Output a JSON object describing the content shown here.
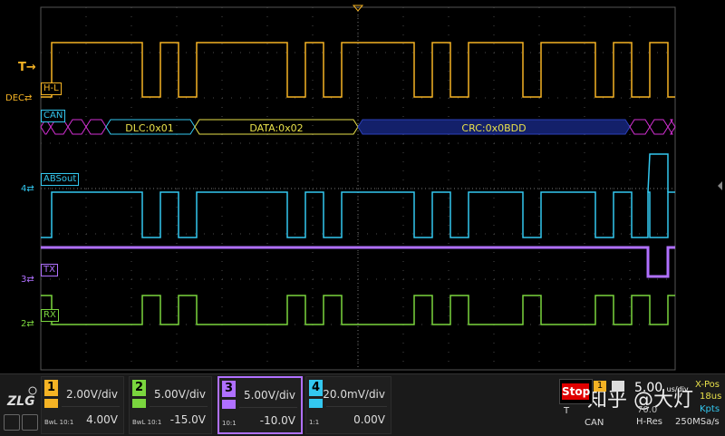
{
  "markers": {
    "trigger": "T",
    "dec": "DEC",
    "ch4_level": "4",
    "ch3_level": "3",
    "ch2_level": "2"
  },
  "trace_labels": {
    "hl": "H-L",
    "can": "CAN",
    "absout": "ABSout",
    "tx": "TX",
    "rx": "RX"
  },
  "decode": {
    "dlc": "DLC:0x01",
    "data": "DATA:0x02",
    "crc": "CRC:0x0BDD"
  },
  "channels": [
    {
      "num": "1",
      "vdiv": "2.00V/div",
      "offset": "4.00V",
      "coupling": "BwL 10:1",
      "color": "#f5b324"
    },
    {
      "num": "2",
      "vdiv": "5.00V/div",
      "offset": "-15.0V",
      "coupling": "BwL 10:1",
      "color": "#7ad63e"
    },
    {
      "num": "3",
      "vdiv": "5.00V/div",
      "offset": "-10.0V",
      "coupling": "10:1",
      "color": "#b070ff"
    },
    {
      "num": "4",
      "vdiv": "20.0mV/div",
      "offset": "0.00V",
      "coupling": "1:1",
      "color": "#33c8f0"
    }
  ],
  "status": {
    "run_state": "Stop",
    "trigger_label": "T",
    "trigger_source": "CAN",
    "timebase": "5.00",
    "timebase_unit": "us/div",
    "xpos_label": "X-Pos",
    "xpos_value": "18us",
    "mem_depth": "Kpts",
    "acq_mode": "H-Res",
    "sample_rate": "250MSa/s",
    "mem_value": "70.0"
  },
  "watermark": "知乎 @大灯",
  "colors": {
    "ch1": "#f5b324",
    "ch2": "#7ad63e",
    "ch3": "#b070ff",
    "ch4": "#33c8f0",
    "can_field": "#e8e04a",
    "can_crc": "#2b3fb8",
    "can_id": "#d430d4",
    "grid": "#404040"
  }
}
